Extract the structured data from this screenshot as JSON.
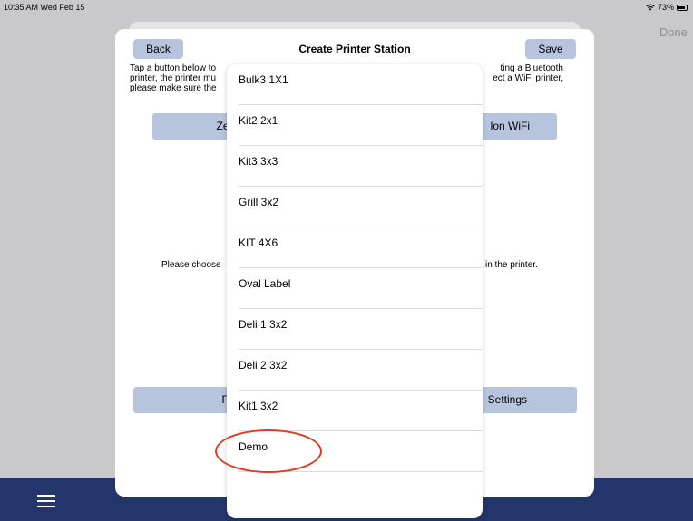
{
  "status_bar": {
    "time": "10:35 AM  Wed Feb 15",
    "battery": "73%",
    "wifi_icon": "wifi-icon",
    "battery_icon": "battery-icon"
  },
  "background": {
    "done_label": "Done",
    "menu_icon": "hamburger-menu-icon"
  },
  "modal": {
    "title": "Create Printer Station",
    "back_label": "Back",
    "save_label": "Save",
    "intro_line1_left": "Tap a button below to",
    "intro_line1_right": "ting a Bluetooth",
    "intro_line2_left": "printer, the printer mu",
    "intro_line2_right": "ect a WiFi printer,",
    "intro_line3_left": "please make sure the",
    "zebra_label": "Zebra W",
    "wifi_label": "lon WiFi",
    "choose_left": "Please choose",
    "choose_right": "in the printer.",
    "print_label": "Print T",
    "settings_label": "Settings"
  },
  "label_options": [
    {
      "label": "Bulk3 1X1"
    },
    {
      "label": "Kit2 2x1"
    },
    {
      "label": "Kit3 3x3"
    },
    {
      "label": "Grill 3x2"
    },
    {
      "label": "KIT 4X6"
    },
    {
      "label": "Oval Label"
    },
    {
      "label": "Deli 1 3x2"
    },
    {
      "label": "Deli 2 3x2"
    },
    {
      "label": "Kit1 3x2"
    },
    {
      "label": "Demo"
    }
  ],
  "colors": {
    "bottom_bar": "#23356a",
    "button": "#b7c4de",
    "annotation": "#e03a22"
  }
}
